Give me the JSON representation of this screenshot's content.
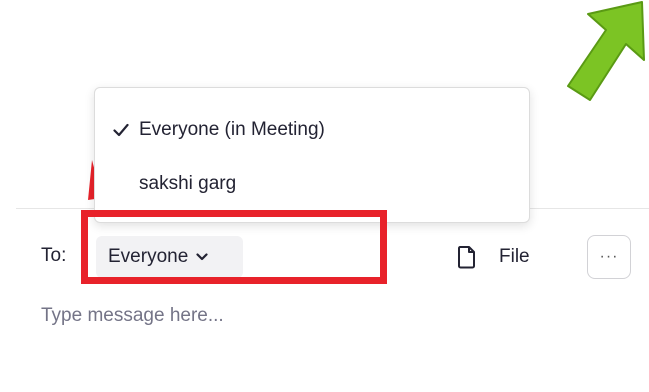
{
  "dropdown": {
    "items": [
      {
        "label": "Everyone (in Meeting)",
        "checked": true
      },
      {
        "label": "sakshi garg",
        "checked": false
      }
    ]
  },
  "composer": {
    "to_label": "To:",
    "recipient_value": "Everyone",
    "file_label": "File",
    "more_label": "···",
    "message_placeholder": "Type message here..."
  },
  "colors": {
    "annotation_red": "#e8222a",
    "annotation_green": "#7cc424",
    "text_primary": "#232333",
    "placeholder": "#747487"
  },
  "icons": {
    "check": "check-icon",
    "chevron": "chevron-down-icon",
    "file": "file-icon",
    "annotation_arrow": "arrow-up-right-icon"
  }
}
